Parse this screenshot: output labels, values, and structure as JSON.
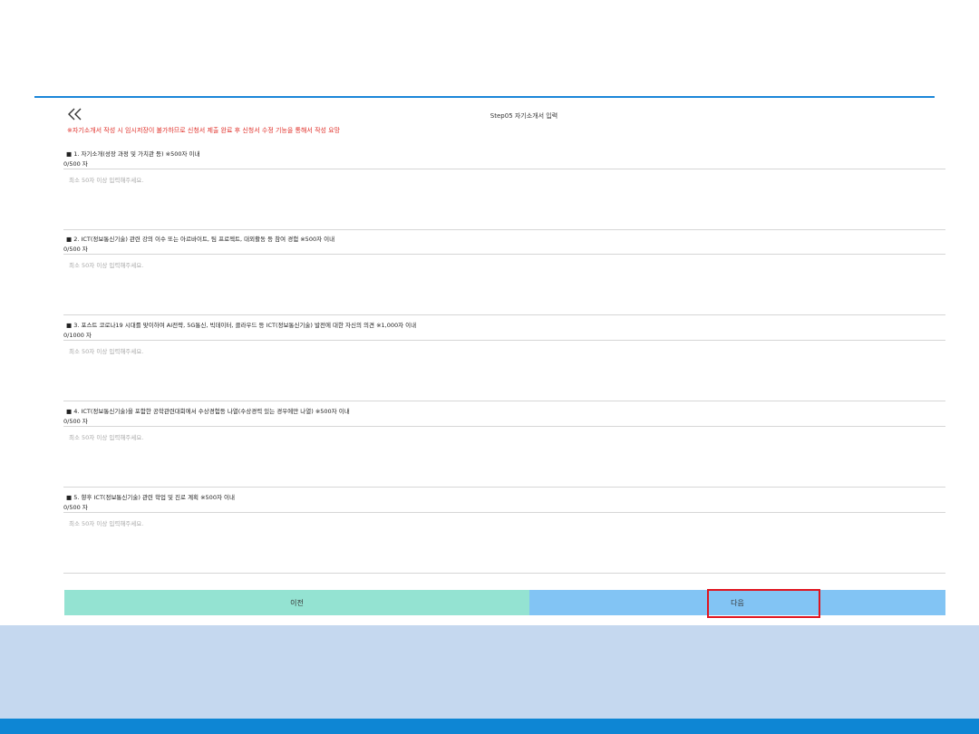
{
  "header": {
    "back_icon": "double-chevron-left-icon",
    "title": "Step05 자기소개서 입력",
    "notice": "※자기소개서 작성 시 임시저장이 불가하므로 신청서 제출 완료 후 신청서 수정 기능을 통해서 작성 요망"
  },
  "sections": [
    {
      "question": "■ 1. 자기소개(성장 과정 및 가치관 등) ※500자 이내",
      "count": "0/500 자",
      "value": "",
      "placeholder": "최소 50자 이상 입력해주세요."
    },
    {
      "question": "■ 2. ICT(정보통신기술) 관련 강의 이수 또는 아르바이트, 팀 프로젝트, 대외활동 등 참여 경험 ※500자 이내",
      "count": "0/500 자",
      "value": "",
      "placeholder": "최소 50자 이상 입력해주세요."
    },
    {
      "question": "■ 3. 포스트 코로나19 시대를 맞이하여 AI전략, 5G통신, 빅데이터, 클라우드 등 ICT(정보통신기술) 발전에 대한 자신의 의견 ※1,000자 이내",
      "count": "0/1000 자",
      "value": "",
      "placeholder": "최소 50자 이상 입력해주세요."
    },
    {
      "question": "■ 4. ICT(정보통신기술)을 포함한 공학관련대회에서 수상경험등 나열(수상경력 있는 경우에만 나열) ※500자 이내",
      "count": "0/500 자",
      "value": "",
      "placeholder": "최소 50자 이상 입력해주세요."
    },
    {
      "question": "■ 5. 향후 ICT(정보통신기술) 관련 학업 및 진로 계획 ※500자 이내",
      "count": "0/500 자",
      "value": "",
      "placeholder": "최소 50자 이상 입력해주세요."
    }
  ],
  "buttons": {
    "prev": "이전",
    "next": "다음"
  },
  "colors": {
    "accent_line": "#1a86d9",
    "notice_red": "#e0302a",
    "prev_button": "#94e3d2",
    "next_button": "#82c4f4",
    "highlight": "#e0141e",
    "footer_band": "#c5d8ef",
    "footer_bar": "#0e86d4"
  }
}
